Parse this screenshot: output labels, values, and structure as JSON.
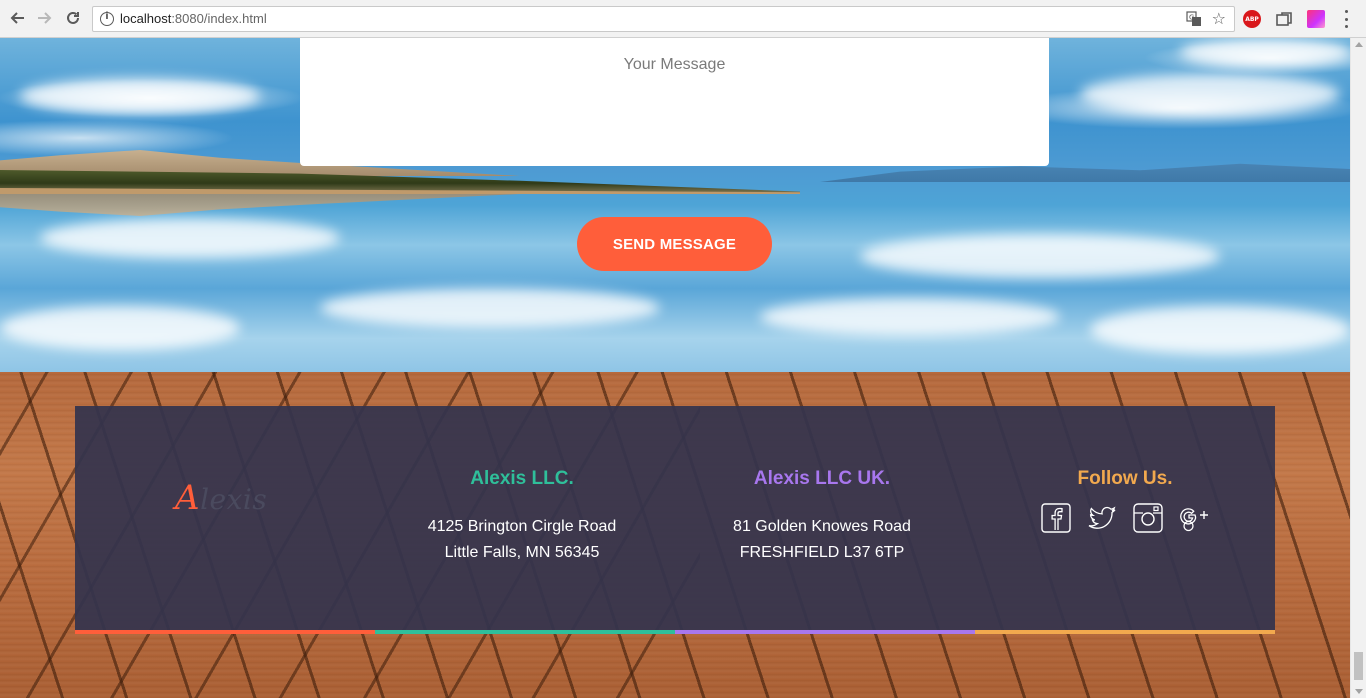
{
  "browser": {
    "url_host": "localhost",
    "url_rest": ":8080/index.html",
    "abp_label": "ABP"
  },
  "contact_form": {
    "message_placeholder": "Your Message",
    "send_label": "SEND MESSAGE"
  },
  "footer": {
    "logo_initial": "A",
    "logo_rest": "lexis",
    "columns": [
      {
        "title": "Alexis LLC.",
        "line1": "4125 Brington Cirgle Road",
        "line2": "Little Falls, MN 56345"
      },
      {
        "title": "Alexis LLC UK.",
        "line1": "81 Golden Knowes Road",
        "line2": "FRESHFIELD L37 6TP"
      }
    ],
    "follow_title": "Follow Us.",
    "social_icons": [
      "facebook-icon",
      "twitter-icon",
      "instagram-icon",
      "google-plus-icon"
    ],
    "bar_colors": [
      "#ff5e3a",
      "#2fbf9a",
      "#a877ee",
      "#f2a94e"
    ]
  },
  "colors": {
    "accent": "#ff5e3a",
    "footer_bg": "#34344e"
  }
}
